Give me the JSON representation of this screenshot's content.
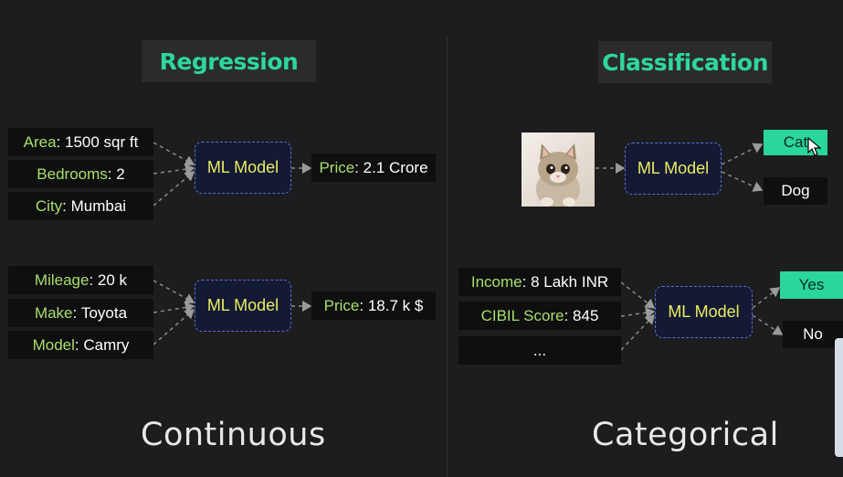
{
  "left": {
    "title": "Regression",
    "footer": "Continuous",
    "example1": {
      "inputs": [
        {
          "key": "Area",
          "value": "1500 sqr ft"
        },
        {
          "key": "Bedrooms",
          "value": "2"
        },
        {
          "key": "City",
          "value": "Mumbai"
        }
      ],
      "model": "ML Model",
      "output": {
        "key": "Price",
        "value": "2.1 Crore"
      }
    },
    "example2": {
      "inputs": [
        {
          "key": "Mileage",
          "value": "20 k"
        },
        {
          "key": "Make",
          "value": "Toyota"
        },
        {
          "key": "Model",
          "value": "Camry"
        }
      ],
      "model": "ML Model",
      "output": {
        "key": "Price",
        "value": "18.7 k $"
      }
    }
  },
  "right": {
    "title": "Classification",
    "footer": "Categorical",
    "example1": {
      "input_image": "kitten-photo",
      "model": "ML Model",
      "outputs": [
        "Cat",
        "Dog"
      ],
      "selected": "Cat"
    },
    "example2": {
      "inputs": [
        {
          "key": "Income",
          "value": "8 Lakh INR"
        },
        {
          "key": "CIBIL Score",
          "value": "845"
        },
        {
          "key": "",
          "value": "..."
        }
      ],
      "model": "ML Model",
      "outputs": [
        "Yes",
        "No"
      ],
      "selected": "Yes"
    }
  },
  "colors": {
    "title_green": "#2fd79a",
    "key_green": "#a8df6e",
    "model_text": "#e9ec63",
    "model_border": "#5b6fc8",
    "selected_bg": "#2bd69a"
  }
}
